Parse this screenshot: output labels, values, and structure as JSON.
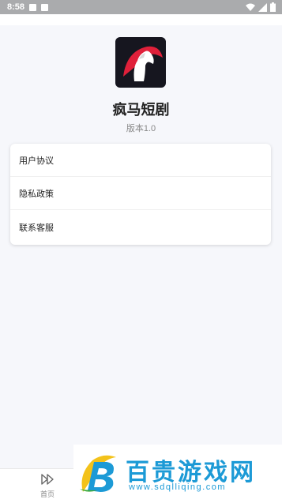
{
  "status_bar": {
    "time": "8:58"
  },
  "app": {
    "name": "疯马短剧",
    "version": "版本1.0"
  },
  "menu": {
    "items": [
      {
        "label": "用户协议"
      },
      {
        "label": "隐私政策"
      },
      {
        "label": "联系客服"
      }
    ]
  },
  "bottom_nav": {
    "home_label": "首页"
  },
  "watermark": {
    "text": "百贵游戏网",
    "url": "www.sdqlliqing.com"
  },
  "colors": {
    "status_bar": "#aaabad",
    "background": "#f6f7fb",
    "logo_bg": "#16161f",
    "logo_accent": "#e0203a",
    "watermark": "#1c9ad6"
  }
}
